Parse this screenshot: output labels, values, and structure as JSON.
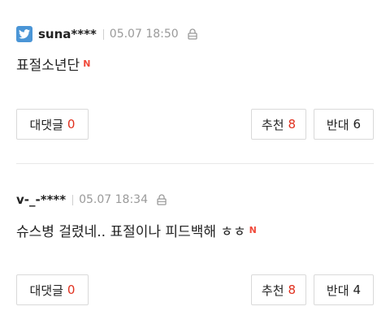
{
  "comments": [
    {
      "nickname": "suna****",
      "time": "05.07 18:50",
      "text": "표절소년단",
      "badge": "N",
      "reply_label": "대댓글",
      "reply_count": "0",
      "recommend_label": "추천",
      "recommend_count": "8",
      "oppose_label": "반대",
      "oppose_count": "6",
      "has_twitter_icon": true
    },
    {
      "nickname": "v-_-****",
      "time": "05.07 18:34",
      "text": "슈스병 걸렸네.. 표절이나 피드백해 ㅎㅎ",
      "badge": "N",
      "reply_label": "대댓글",
      "reply_count": "0",
      "recommend_label": "추천",
      "recommend_count": "8",
      "oppose_label": "반대",
      "oppose_count": "4",
      "has_twitter_icon": false
    }
  ],
  "colors": {
    "twitter_blue": "#4a95d6",
    "count_red": "#e0301e",
    "new_badge_red": "#f0493a",
    "meta_gray": "#9a9a9a"
  },
  "icons": [
    "twitter-icon",
    "lock-icon",
    "new-badge-icon"
  ]
}
